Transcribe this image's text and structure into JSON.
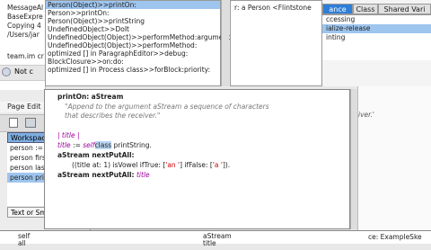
{
  "console": {
    "lines": [
      "MessageAl",
      "BaseExpre",
      "Copying 4",
      "/Users/jar",
      "team.im cr"
    ],
    "status": "Not c"
  },
  "stack": {
    "items": [
      "Person(Object)>>printOn:",
      "Person>>printOn:",
      "Person(Object)>>printString",
      "UndefinedObject>>DoIt",
      "UndefinedObject(Object)>>performMethod:arguments:",
      "UndefinedObject(Object)>>performMethod:",
      "optimized [] in ParagraphEditor>>debug:",
      "BlockClosure>>on:do:",
      "optimized [] in Process class>>forBlock:priority:"
    ],
    "selected_index": 0
  },
  "receiver": {
    "text": "r: a Person <Flintstone"
  },
  "browser": {
    "tabs": [
      "ance",
      "Class",
      "Shared Vari"
    ],
    "active_tab": 0,
    "protocols": [
      "ccessing",
      "ialize-release",
      "inting"
    ],
    "selected_protocol": 1
  },
  "workspace": {
    "menu": [
      "Page",
      "Edit"
    ],
    "title": "Workspace",
    "lines": [
      "person := F",
      "person first",
      "person last",
      "person print"
    ],
    "selected_line": 3,
    "button": "Text or Sma"
  },
  "code": {
    "signature_keyword": "printOn:",
    "signature_arg": "aStream",
    "comment_line1": "\"Append to the argument aStream a sequence of characters",
    "comment_line2": "that describes the receiver.\"",
    "temps": "| title |",
    "line_assign_var": "title",
    "line_assign_op": ":=",
    "line_assign_self": "self",
    "line_assign_class": "class",
    "line_assign_rest": "printString.",
    "line_stream": "aStream nextPutAll:",
    "line_cond_open": "((title at: 1) isVowel ifTrue: [",
    "str_an": "'an '",
    "line_cond_mid": "] ifFalse: [",
    "str_a": "'a '",
    "line_cond_close": "]).",
    "line_last_recv": "aStream nextPutAll:",
    "line_last_arg": "title"
  },
  "rightedge": {
    "text": "iver.'"
  },
  "bottom": {
    "left": [
      "self",
      "all"
    ],
    "mid": [
      "aStream",
      "title"
    ],
    "right": "ce: ExampleSke"
  }
}
